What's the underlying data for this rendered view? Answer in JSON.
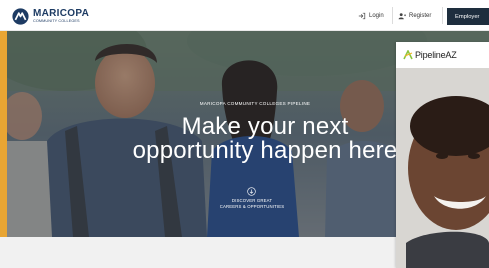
{
  "header": {
    "logo_name": "MARICOPA",
    "logo_sub": "COMMUNITY COLLEGES",
    "login_label": "Login",
    "register_label": "Register",
    "employer_label": "Employer"
  },
  "hero": {
    "eyebrow": "MARICOPA COMMUNITY COLLEGES PIPELINE",
    "headline_line1": "Make your next",
    "headline_line2": "opportunity happen here",
    "discover_line1": "DISCOVER GREAT",
    "discover_line2": "CAREERS & OPPORTUNITIES"
  },
  "pipeline_card": {
    "logo_text": "PipelineAZ"
  },
  "colors": {
    "brand_navy": "#1d3b63",
    "employer_button": "#1e2e3e",
    "accent_orange": "#e8a533",
    "pipeline_green": "#8cc63f"
  },
  "icons": {
    "login": "sign-in-icon",
    "register": "user-plus-icon",
    "discover": "arrow-down-circle-icon"
  }
}
